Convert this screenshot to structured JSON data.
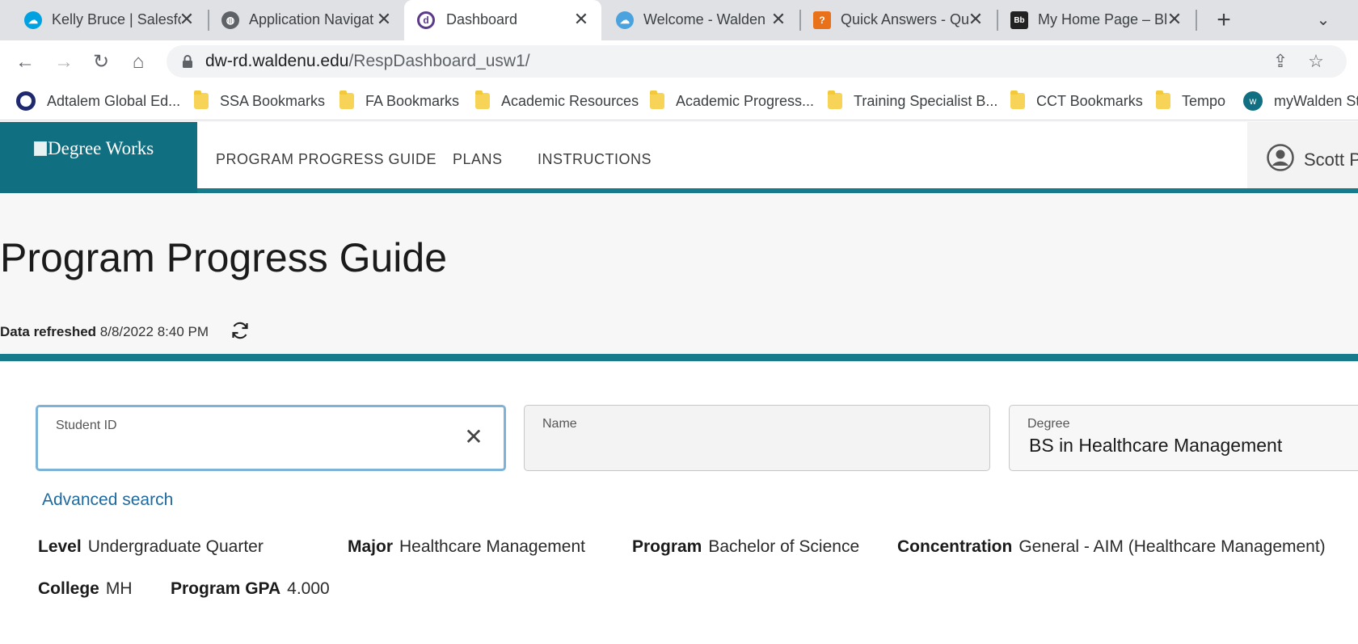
{
  "browser": {
    "tabs": [
      {
        "title": "Kelly Bruce | Salesfo",
        "icon": "salesforce-cloud-icon",
        "color": "#00a1e0"
      },
      {
        "title": "Application Navigat",
        "icon": "globe-icon",
        "color": "#5f6368"
      },
      {
        "title": "Dashboard",
        "icon": "dashboard-app-icon",
        "color": "#5b3a8a",
        "active": true
      },
      {
        "title": "Welcome - Walden",
        "icon": "cloud-icon",
        "color": "#4aa3df"
      },
      {
        "title": "Quick Answers - Qu",
        "icon": "question-icon",
        "color": "#e8711a"
      },
      {
        "title": "My Home Page – Bl",
        "icon": "blackboard-icon",
        "color": "#222222"
      }
    ],
    "url_host": "dw-rd.waldenu.edu",
    "url_path": "/RespDashboard_usw1/",
    "bookmarks": [
      {
        "label": "Adtalem Global Ed...",
        "icon": "adtalem-logo-icon"
      },
      {
        "label": "SSA Bookmarks",
        "icon": "folder-icon"
      },
      {
        "label": "FA Bookmarks",
        "icon": "folder-icon"
      },
      {
        "label": "Academic Resources",
        "icon": "folder-icon"
      },
      {
        "label": "Academic Progress...",
        "icon": "folder-icon"
      },
      {
        "label": "Training Specialist B...",
        "icon": "folder-icon"
      },
      {
        "label": "CCT Bookmarks",
        "icon": "folder-icon"
      },
      {
        "label": "Tempo",
        "icon": "folder-icon"
      },
      {
        "label": "myWalden Stu",
        "icon": "walden-logo-icon"
      }
    ]
  },
  "app": {
    "logo_alt": "Degree Works",
    "nav": [
      "PROGRAM PROGRESS GUIDE",
      "PLANS",
      "INSTRUCTIONS"
    ],
    "user_name": "Scott P",
    "brand_color": "#106f81"
  },
  "page": {
    "title": "Program Progress Guide",
    "refresh_label": "Data refreshed",
    "refresh_time": "8/8/2022 8:40 PM"
  },
  "search": {
    "student_id_label": "Student ID",
    "student_id_value": "",
    "name_label": "Name",
    "name_value": "",
    "degree_label": "Degree",
    "degree_value": "BS in Healthcare Management",
    "advanced_search": "Advanced search"
  },
  "student": {
    "level_label": "Level",
    "level_value": "Undergraduate Quarter",
    "major_label": "Major",
    "major_value": "Healthcare Management",
    "program_label": "Program",
    "program_value": "Bachelor of Science",
    "concentration_label": "Concentration",
    "concentration_value": "General - AIM (Healthcare Management)",
    "college_label": "College",
    "college_value": "MH",
    "gpa_label": "Program GPA",
    "gpa_value": "4.000"
  }
}
